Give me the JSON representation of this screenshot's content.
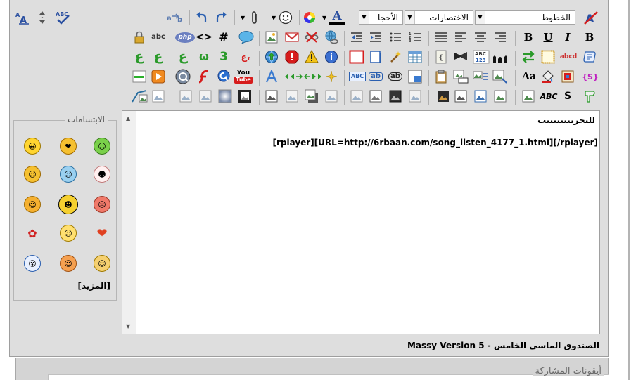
{
  "toolbar": {
    "fonts_label": "الخطوط",
    "shortcuts_label": "الاختصارات",
    "sizes_label": "الأحجا",
    "font_color_letter": "A"
  },
  "left_toolbar": {
    "spell_label": "ABC"
  },
  "icons": {
    "php_label": "php",
    "code_label": "<>",
    "hash_label": "#",
    "bold_label": "B",
    "underline_label": "U",
    "italic_label": "I",
    "bold2_label": "B",
    "abc123_label": "ABC",
    "abcd_label": "abcd",
    "font_size_label": "Aa",
    "abc_label": "ABC",
    "s_label": "S",
    "youtube_label": "You",
    "ab1_label": "ab",
    "ab2_label": "ab",
    "abc_box_label": "ABC",
    "bracket_s_label": "{S}",
    "ain_label": "ع",
    "ain2_label": "ع",
    "arabic_w_label": "ω",
    "arabic_3_label": "3",
    "arabic_ah_label": "ع،"
  },
  "smilies": {
    "legend": "الابتسامات",
    "more": "[المزيد]"
  },
  "editor": {
    "line1": "للتجرببببببببب",
    "line2": "[rplayer][URL=http://6rbaan.com/song_listen_4177_1.html][/rplayer]"
  },
  "footer": {
    "version": "الصندوق الماسي الخامس - Massy Version 5",
    "next_section": "أيقونات المشاركة"
  },
  "colors": {
    "panel_bg": "#dedede",
    "accent_blue": "#2a4fa0",
    "red": "#d61c1c"
  }
}
